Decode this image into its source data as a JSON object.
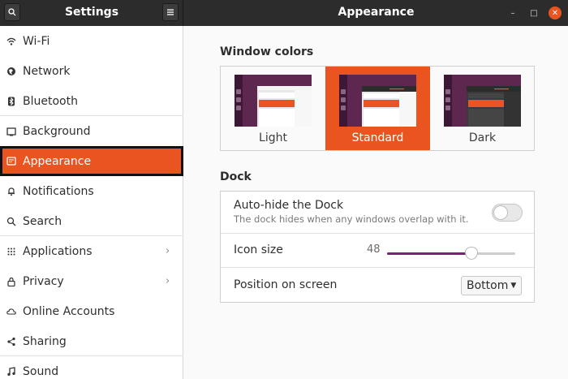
{
  "header": {
    "left_title": "Settings",
    "right_title": "Appearance",
    "search_icon": "search-icon",
    "menu_icon": "hamburger-menu-icon"
  },
  "sidebar": {
    "items": [
      {
        "label": "Wi-Fi",
        "icon": "wifi-icon"
      },
      {
        "label": "Network",
        "icon": "network-icon"
      },
      {
        "label": "Bluetooth",
        "icon": "bluetooth-icon"
      },
      {
        "label": "Background",
        "icon": "background-icon"
      },
      {
        "label": "Appearance",
        "icon": "appearance-icon",
        "active": true
      },
      {
        "label": "Notifications",
        "icon": "bell-icon"
      },
      {
        "label": "Search",
        "icon": "search-icon"
      },
      {
        "label": "Applications",
        "icon": "applications-grid-icon",
        "chevron": true
      },
      {
        "label": "Privacy",
        "icon": "lock-icon",
        "chevron": true
      },
      {
        "label": "Online Accounts",
        "icon": "cloud-icon"
      },
      {
        "label": "Sharing",
        "icon": "share-icon"
      },
      {
        "label": "Sound",
        "icon": "music-note-icon"
      }
    ]
  },
  "main": {
    "window_colors_title": "Window colors",
    "themes": [
      {
        "label": "Light",
        "selected": false
      },
      {
        "label": "Standard",
        "selected": true
      },
      {
        "label": "Dark",
        "selected": false
      }
    ],
    "dock_title": "Dock",
    "autohide": {
      "title": "Auto-hide the Dock",
      "subtitle": "The dock hides when any windows overlap with it.",
      "enabled": false
    },
    "icon_size": {
      "label": "Icon size",
      "value": "48",
      "fraction": 0.66
    },
    "position": {
      "label": "Position on screen",
      "value": "Bottom"
    }
  },
  "colors": {
    "accent": "#e95420",
    "aubergine": "#5e2750",
    "headerbar": "#2c2c2c"
  }
}
